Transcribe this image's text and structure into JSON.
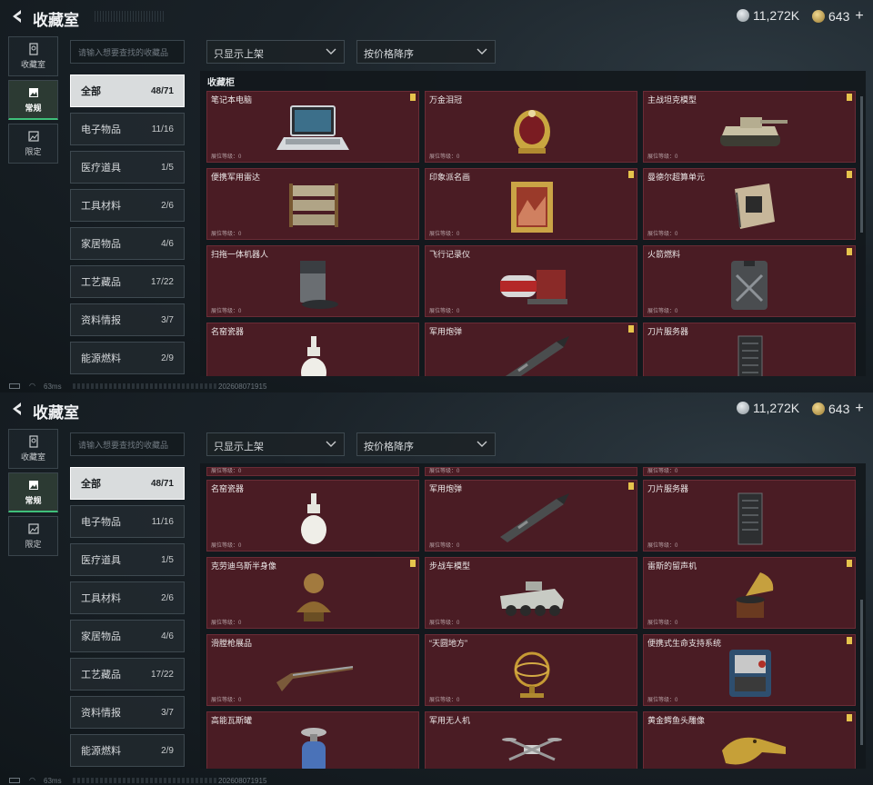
{
  "header": {
    "title": "收藏室",
    "silver_amount": "11,272K",
    "gold_amount": "643",
    "plus_label": "+"
  },
  "rail": [
    {
      "label": "收藏室",
      "icon": "building-icon"
    },
    {
      "label": "常规",
      "icon": "image-icon",
      "active": true
    },
    {
      "label": "限定",
      "icon": "image-limited-icon"
    }
  ],
  "search": {
    "placeholder": "请输入想要查找的收藏品"
  },
  "filters": {
    "shelf_filter": "只显示上架",
    "sort": "按价格降序"
  },
  "panel_title": "收藏柜",
  "categories": [
    {
      "label": "全部",
      "count": "48/71",
      "active": true
    },
    {
      "label": "电子物品",
      "count": "11/16"
    },
    {
      "label": "医疗道具",
      "count": "1/5"
    },
    {
      "label": "工具材料",
      "count": "2/6"
    },
    {
      "label": "家居物品",
      "count": "4/6"
    },
    {
      "label": "工艺藏品",
      "count": "17/22"
    },
    {
      "label": "资料情报",
      "count": "3/7"
    },
    {
      "label": "能源燃料",
      "count": "2/9"
    }
  ],
  "level_text": "展位等级：0",
  "view1_items": [
    {
      "name": "笔记本电脑",
      "art": "laptop",
      "flag": true
    },
    {
      "name": "万金泪冠",
      "art": "egg",
      "flag": false
    },
    {
      "name": "主战坦克模型",
      "art": "tank",
      "flag": true
    },
    {
      "name": "便携军用雷达",
      "art": "radar",
      "flag": false
    },
    {
      "name": "印象派名画",
      "art": "painting",
      "flag": true
    },
    {
      "name": "曼德尔超算单元",
      "art": "chip",
      "flag": true
    },
    {
      "name": "扫拖一体机器人",
      "art": "robot",
      "flag": false
    },
    {
      "name": "飞行记录仪",
      "art": "recorder",
      "flag": false
    },
    {
      "name": "火箭燃料",
      "art": "fuel",
      "flag": true
    },
    {
      "name": "名窑瓷器",
      "art": "vase",
      "flag": false
    },
    {
      "name": "军用炮弹",
      "art": "shell",
      "flag": true
    },
    {
      "name": "刀片服务器",
      "art": "server",
      "flag": false
    }
  ],
  "view2_items": [
    {
      "name": "名窑瓷器",
      "art": "vase",
      "flag": false
    },
    {
      "name": "军用炮弹",
      "art": "shell",
      "flag": true
    },
    {
      "name": "刀片服务器",
      "art": "server",
      "flag": false
    },
    {
      "name": "克劳迪乌斯半身像",
      "art": "bust",
      "flag": true
    },
    {
      "name": "步战车模型",
      "art": "ifv",
      "flag": false
    },
    {
      "name": "雷斯的留声机",
      "art": "phonograph",
      "flag": true
    },
    {
      "name": "滑膛枪展品",
      "art": "musket",
      "flag": false
    },
    {
      "name": "“天圆地方”",
      "art": "armillary",
      "flag": false
    },
    {
      "name": "便携式生命支持系统",
      "art": "lifesupport",
      "flag": true
    },
    {
      "name": "高能瓦斯罐",
      "art": "gas",
      "flag": false
    },
    {
      "name": "军用无人机",
      "art": "drone",
      "flag": false
    },
    {
      "name": "黄金鳄鱼头雕像",
      "art": "croc",
      "flag": true
    }
  ],
  "status": {
    "ping": "63ms",
    "stamp": "202608071915"
  }
}
